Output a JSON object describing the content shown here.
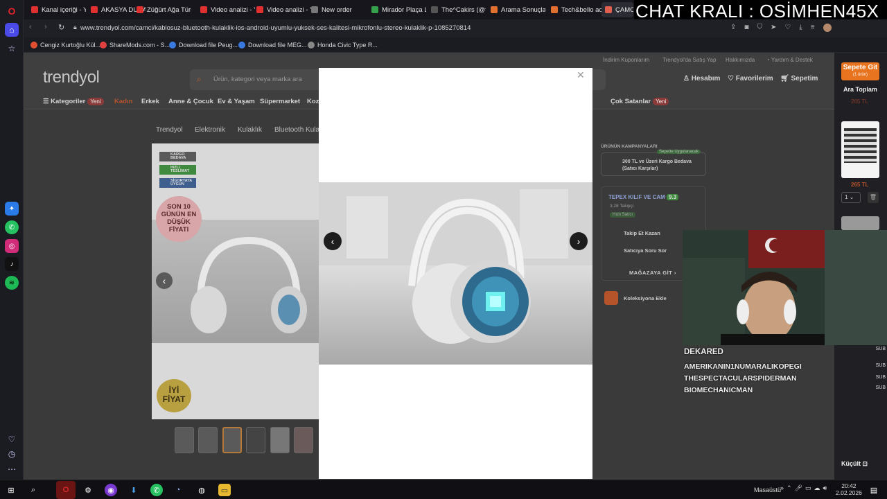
{
  "overlay_text": "CHAT KRALI : OSİMHEN45X",
  "tabs": [
    {
      "label": "Kanal içeriği - Yo",
      "color": "#e03030"
    },
    {
      "label": "AKASYA DURAĞI",
      "color": "#e03030"
    },
    {
      "label": "Züğürt Ağa Türk",
      "color": "#e03030"
    },
    {
      "label": "Video analizi - Yo",
      "color": "#e03030"
    },
    {
      "label": "Video analizi - Yo",
      "color": "#e03030"
    },
    {
      "label": "New order",
      "color": "#777"
    },
    {
      "label": "Mirador Plaça La",
      "color": "#37a04a"
    },
    {
      "label": "The^Cakirs (@th",
      "color": "#555"
    },
    {
      "label": "Arama Sonuçları",
      "color": "#e07030"
    },
    {
      "label": "Tech&bello acce",
      "color": "#e07030"
    },
    {
      "label": "ÇAMCI K",
      "color": "#e06050"
    }
  ],
  "address": {
    "url": "www.trendyol.com/camci/kablosuz-bluetooth-kulaklik-ios-android-uyumlu-yuksek-ses-kalitesi-mikrofonlu-stereo-kulaklik-p-1085270814"
  },
  "bookmarks": [
    "Cengiz Kurtoğlu Kül...",
    "ShareMods.com - S...",
    "Download file Peug...",
    "Download file MEG...",
    "Honda Civic Type R..."
  ],
  "site": {
    "logo": "trendyol",
    "search_placeholder": "Ürün, kategori veya marka ara",
    "top_links": [
      "İndirim Kuponlarım",
      "Trendyol'da Satış Yap",
      "Hakkımızda",
      "Yardım & Destek"
    ],
    "account": [
      "Hesabım",
      "Favorilerim",
      "Sepetim"
    ],
    "cart_count": "1",
    "nav": {
      "categories": "Kategoriler",
      "new": "Yeni",
      "items": [
        "Kadın",
        "Erkek",
        "Anne & Çocuk",
        "Ev & Yaşam",
        "Süpermarket",
        "Koz"
      ],
      "right": "Çok Satanlar"
    },
    "breadcrumb": [
      "Trendyol",
      "Elektronik",
      "Kulaklık",
      "Bluetooth Kulak"
    ],
    "badges": [
      "KARGO BEDAVA",
      "HIZLI TESLİMAT",
      "SİGORTAYA UYGUN"
    ],
    "promo_circle": "SON 10 GÜNÜN EN DÜŞÜK FİYATI",
    "iyi_fiyat": "İYİ FİYAT",
    "campaigns_title": "ÜRÜNÜN KAMPANYALARI",
    "campaign_tag": "Sepette Uygulanacak",
    "campaign": "300 TL ve Üzeri Kargo Bedava (Satıcı Karşılar)",
    "seller": {
      "name": "TEPEX KILIF VE CAM",
      "score": "9.3",
      "followers": "3,28 Takipçi",
      "fast": "Hızlı Satıcı"
    },
    "follow": "Takip Et Kazan",
    "ask": "Satıcıya Soru Sor",
    "store": "MAĞAZAYA GİT",
    "collection": "Koleksiyona Ekle"
  },
  "basket_panel": {
    "button": "Sepete Git",
    "sub": "(1 ürün)",
    "total_label": "Ara Toplam",
    "total": "265 TL",
    "item_price": "265 TL",
    "qty": "1",
    "shrink": "Küçült"
  },
  "chat": {
    "user": "DEKARED",
    "lines": [
      "AMERIKANIN1NUMARALIKOPEGI",
      "THESPECTACULARSPIDERMAN",
      "BIOMECHANICMAN"
    ],
    "sub": "SUB"
  },
  "taskbar": {
    "desktop": "Masaüstü",
    "time": "20:42",
    "date": "2.02.2026"
  },
  "colors": {
    "accent": "#f27a1a",
    "dark_bg": "#1c1c1e"
  }
}
